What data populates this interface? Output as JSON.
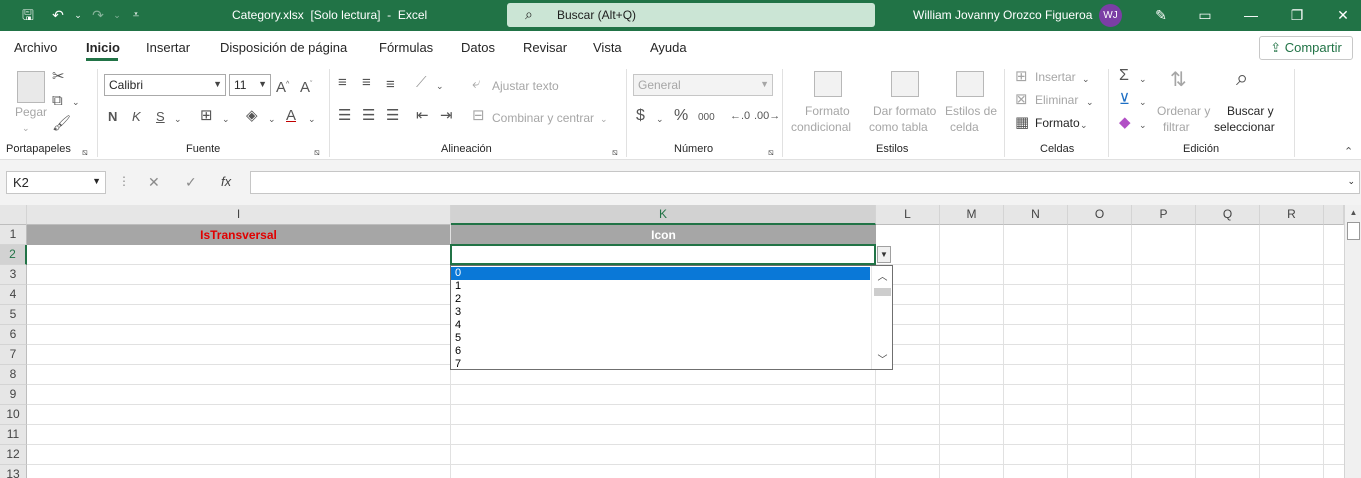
{
  "app": {
    "title": "Category.xlsx  [Solo lectura]  -  Excel",
    "search_placeholder": "Buscar (Alt+Q)",
    "user_name": "William Jovanny Orozco Figueroa",
    "user_initials": "WJ",
    "accent_color": "#217346"
  },
  "tabs": [
    "Archivo",
    "Inicio",
    "Insertar",
    "Disposición de página",
    "Fórmulas",
    "Datos",
    "Revisar",
    "Vista",
    "Ayuda"
  ],
  "active_tab": "Inicio",
  "share_label": "Compartir",
  "ribbon": {
    "portapapeles": {
      "paste": "Pegar",
      "group": "Portapapeles"
    },
    "fuente": {
      "font": "Calibri",
      "size": "11",
      "bold": "N",
      "italic": "K",
      "underline": "S",
      "group": "Fuente"
    },
    "alineacion": {
      "wrap": "Ajustar texto",
      "merge": "Combinar y centrar",
      "group": "Alineación"
    },
    "numero": {
      "format": "General",
      "group": "Número",
      "percent": "%",
      "thousands": "000",
      "currency": "$"
    },
    "estilos": {
      "cond_1": "Formato",
      "cond_2": "condicional",
      "table_1": "Dar formato",
      "table_2": "como tabla",
      "cell_1": "Estilos de",
      "cell_2": "celda",
      "group": "Estilos"
    },
    "celdas": {
      "insert": "Insertar",
      "delete": "Eliminar",
      "format": "Formato",
      "group": "Celdas"
    },
    "edicion": {
      "sort_1": "Ordenar y",
      "sort_2": "filtrar",
      "find_1": "Buscar y",
      "find_2": "seleccionar",
      "group": "Edición"
    }
  },
  "formula_bar": {
    "name_box": "K2",
    "fx": "fx",
    "value": ""
  },
  "columns": [
    "I",
    "K",
    "L",
    "M",
    "N",
    "O",
    "P",
    "Q",
    "R"
  ],
  "rows": [
    "1",
    "2",
    "3",
    "4",
    "5",
    "6",
    "7",
    "8",
    "9",
    "10",
    "11",
    "12",
    "13"
  ],
  "cells": {
    "I1": "IsTransversal",
    "K1": "Icon",
    "I1_color": "#e00000"
  },
  "dropdown": {
    "options": [
      "0",
      "1",
      "2",
      "3",
      "4",
      "5",
      "6",
      "7"
    ],
    "selected": "0"
  }
}
